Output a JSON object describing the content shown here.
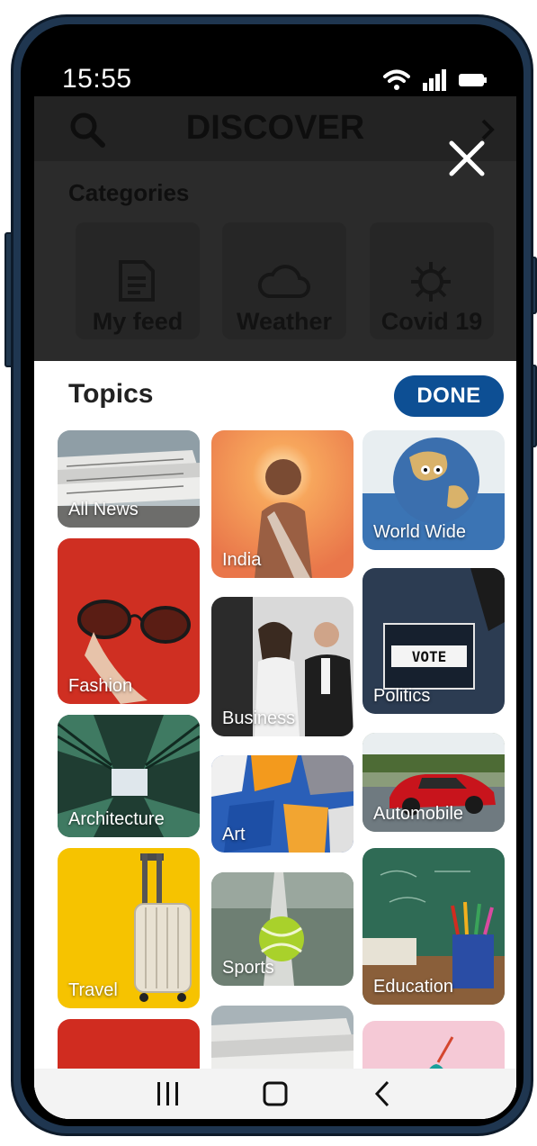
{
  "status_bar": {
    "time": "15:55"
  },
  "discover": {
    "title": "DISCOVER",
    "categories_title": "Categories",
    "categories": [
      {
        "label": "My feed",
        "icon": "document-icon"
      },
      {
        "label": "Weather",
        "icon": "cloud-icon"
      },
      {
        "label": "Covid 19",
        "icon": "virus-icon"
      }
    ]
  },
  "topics": {
    "title": "Topics",
    "done_label": "DONE",
    "items": [
      {
        "label": "All News"
      },
      {
        "label": "India"
      },
      {
        "label": "World Wide"
      },
      {
        "label": "Fashion"
      },
      {
        "label": "Business"
      },
      {
        "label": "Politics"
      },
      {
        "label": "Architecture"
      },
      {
        "label": "Art"
      },
      {
        "label": "Automobile"
      },
      {
        "label": "Travel"
      },
      {
        "label": "Sports"
      },
      {
        "label": "Education"
      }
    ]
  },
  "colors": {
    "accent": "#0d4f94",
    "frame": "#1f3650"
  }
}
